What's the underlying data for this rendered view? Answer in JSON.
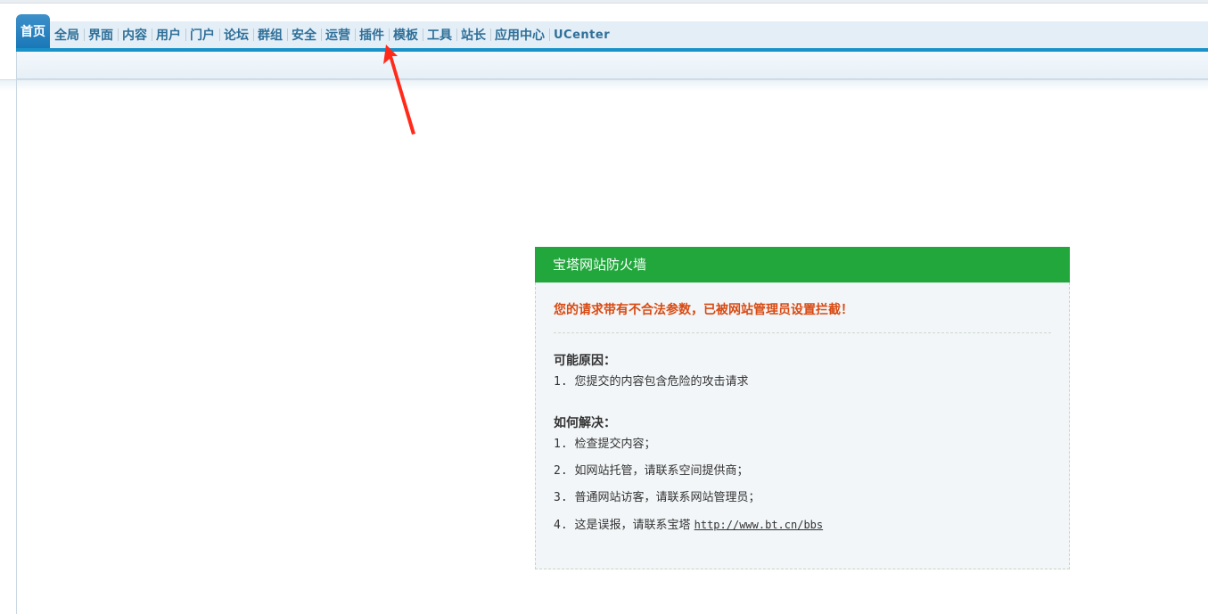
{
  "nav": {
    "items": [
      {
        "label": "首页",
        "active": true
      },
      {
        "label": "全局"
      },
      {
        "label": "界面"
      },
      {
        "label": "内容"
      },
      {
        "label": "用户"
      },
      {
        "label": "门户"
      },
      {
        "label": "论坛"
      },
      {
        "label": "群组"
      },
      {
        "label": "安全"
      },
      {
        "label": "运营"
      },
      {
        "label": "插件"
      },
      {
        "label": "模板"
      },
      {
        "label": "工具"
      },
      {
        "label": "站长"
      },
      {
        "label": "应用中心"
      },
      {
        "label": "UCenter"
      }
    ]
  },
  "annotation": {
    "icon": "red-arrow-icon",
    "color": "#ff2a1a"
  },
  "firewall": {
    "title": "宝塔网站防火墙",
    "alert": "您的请求带有不合法参数，已被网站管理员设置拦截！",
    "reasons_heading": "可能原因：",
    "reasons": [
      {
        "num": "1.",
        "text": "您提交的内容包含危险的攻击请求"
      }
    ],
    "solutions_heading": "如何解决：",
    "solutions": [
      {
        "num": "1.",
        "text": "检查提交内容；"
      },
      {
        "num": "2.",
        "text": "如网站托管，请联系空间提供商；"
      },
      {
        "num": "3.",
        "text": "普通网站访客，请联系网站管理员；"
      },
      {
        "num": "4.",
        "text": "这是误报，请联系宝塔 ",
        "link": "http://www.bt.cn/bbs"
      }
    ],
    "colors": {
      "header": "#21a73c",
      "alert": "#d94a12",
      "body": "#f2f6f8"
    }
  }
}
